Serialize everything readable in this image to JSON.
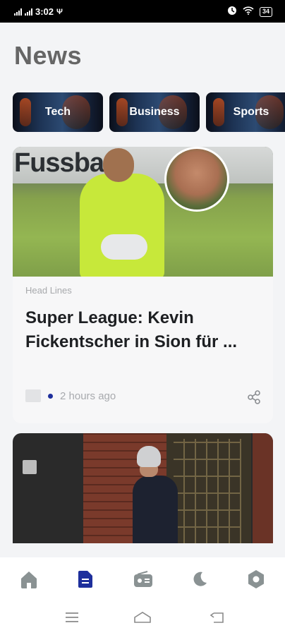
{
  "status_bar": {
    "time": "3:02",
    "battery": "34"
  },
  "header": {
    "title": "News"
  },
  "categories": [
    {
      "label": "Tech"
    },
    {
      "label": "Business"
    },
    {
      "label": "Sports"
    }
  ],
  "articles": [
    {
      "label": "Head Lines",
      "title": "Super League: Kevin Fickentscher in Sion für ...",
      "time": "2 hours ago",
      "hero_text": "Fussba"
    }
  ],
  "colors": {
    "accent": "#1e2f9c",
    "nav_inactive": "#8a9293",
    "background": "#f3f4f6"
  },
  "bottom_nav": [
    {
      "icon": "home-icon",
      "active": false
    },
    {
      "icon": "document-icon",
      "active": true
    },
    {
      "icon": "radio-icon",
      "active": false
    },
    {
      "icon": "moon-icon",
      "active": false
    },
    {
      "icon": "settings-icon",
      "active": false
    }
  ],
  "system_nav": [
    {
      "icon": "menu-icon"
    },
    {
      "icon": "home-outline-icon"
    },
    {
      "icon": "back-icon"
    }
  ]
}
